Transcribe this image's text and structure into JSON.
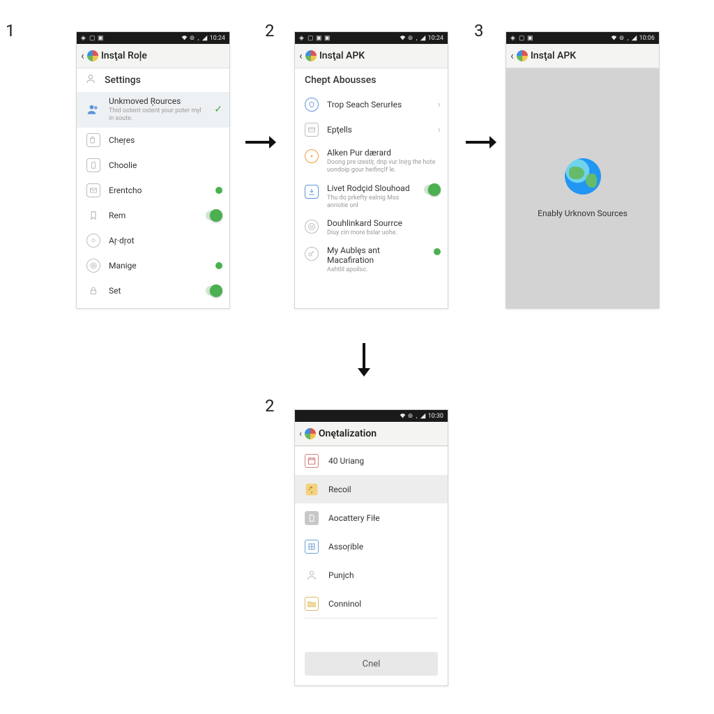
{
  "step_numbers": {
    "one": "1",
    "two_top": "2",
    "three": "3",
    "two_bottom": "2"
  },
  "status": {
    "time1": "10:24",
    "time2": "10:24",
    "time3": "10:06",
    "time4": "10:30"
  },
  "phone1": {
    "title": "Insţal Roļe",
    "section": "Settings",
    "unknown": {
      "title": "Unkmoved Ŗources",
      "desc": "Thid ootent ostent your poter myl in soute."
    },
    "items": {
      "chenes": "Cheŗes",
      "choolie": "Choolie",
      "erentcho": "Erentcho",
      "rem": "Rem",
      "ardot": "Aŗ·dŗot",
      "manige": "Manige",
      "set": "Set"
    }
  },
  "phone2": {
    "title": "Insţal APK",
    "section": "Chept Abousses",
    "items": {
      "trop": "Trop Seach Serurłes",
      "eptells": "Epţells",
      "alken": {
        "title": "Alken Pur dærard",
        "desc": "Doong pre izestiŗ, dnp vur lniŗg the hote uondoip gour heifinçlf le."
      },
      "livet": {
        "title": "Livet Rodçid Slouhoad",
        "desc": "Thu do prkefty ealnig Mss anriotie onl"
      },
      "douh": {
        "title": "Douhlinkard Sourrce",
        "desc": "Diuy cin more bslar uohe."
      },
      "myaub": {
        "title": "My Aublęs ant Macafiration",
        "desc": "Ashtlil apoilsc."
      }
    }
  },
  "phone3": {
    "title": "Insţal APK",
    "body_text": "Enabły Urknovn Sources"
  },
  "phone4": {
    "title": "Onętalization",
    "items": {
      "uriang": "40 Uriang",
      "recoil": "Recoil",
      "aocattery": "Aocattery Fiłe",
      "assorible": "Assoŗible",
      "punjch": "Punjch",
      "conninol": "Conninol"
    },
    "button": "Cnel"
  }
}
